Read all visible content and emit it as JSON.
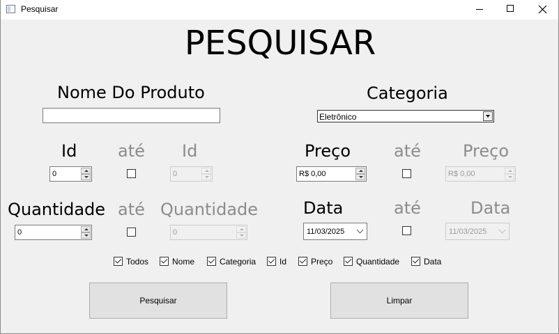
{
  "window": {
    "title": "Pesquisar"
  },
  "heading": "PESQUISAR",
  "nome_produto": {
    "label": "Nome Do Produto",
    "value": ""
  },
  "categoria": {
    "label": "Categoria",
    "selected": "Eletrônico"
  },
  "id": {
    "label": "Id",
    "range_label": "até",
    "to_label": "Id",
    "from_value": "0",
    "to_value": "0",
    "range_checked": false
  },
  "preco": {
    "label": "Preço",
    "range_label": "até",
    "to_label": "Preço",
    "from_value": "R$ 0,00",
    "to_value": "R$ 0,00",
    "range_checked": false
  },
  "quantidade": {
    "label": "Quantidade",
    "range_label": "até",
    "to_label": "Quantidade",
    "from_value": "0",
    "to_value": "0",
    "range_checked": false
  },
  "data": {
    "label": "Data",
    "range_label": "até",
    "to_label": "Data",
    "from_value": "11/03/2025",
    "to_value": "11/03/2025",
    "range_checked": false
  },
  "filters": [
    {
      "label": "Todos",
      "checked": true
    },
    {
      "label": "Nome",
      "checked": true
    },
    {
      "label": "Categoria",
      "checked": true
    },
    {
      "label": "Id",
      "checked": true
    },
    {
      "label": "Preço",
      "checked": true
    },
    {
      "label": "Quantidade",
      "checked": true
    },
    {
      "label": "Data",
      "checked": true
    }
  ],
  "buttons": {
    "search": "Pesquisar",
    "clear": "Limpar"
  }
}
